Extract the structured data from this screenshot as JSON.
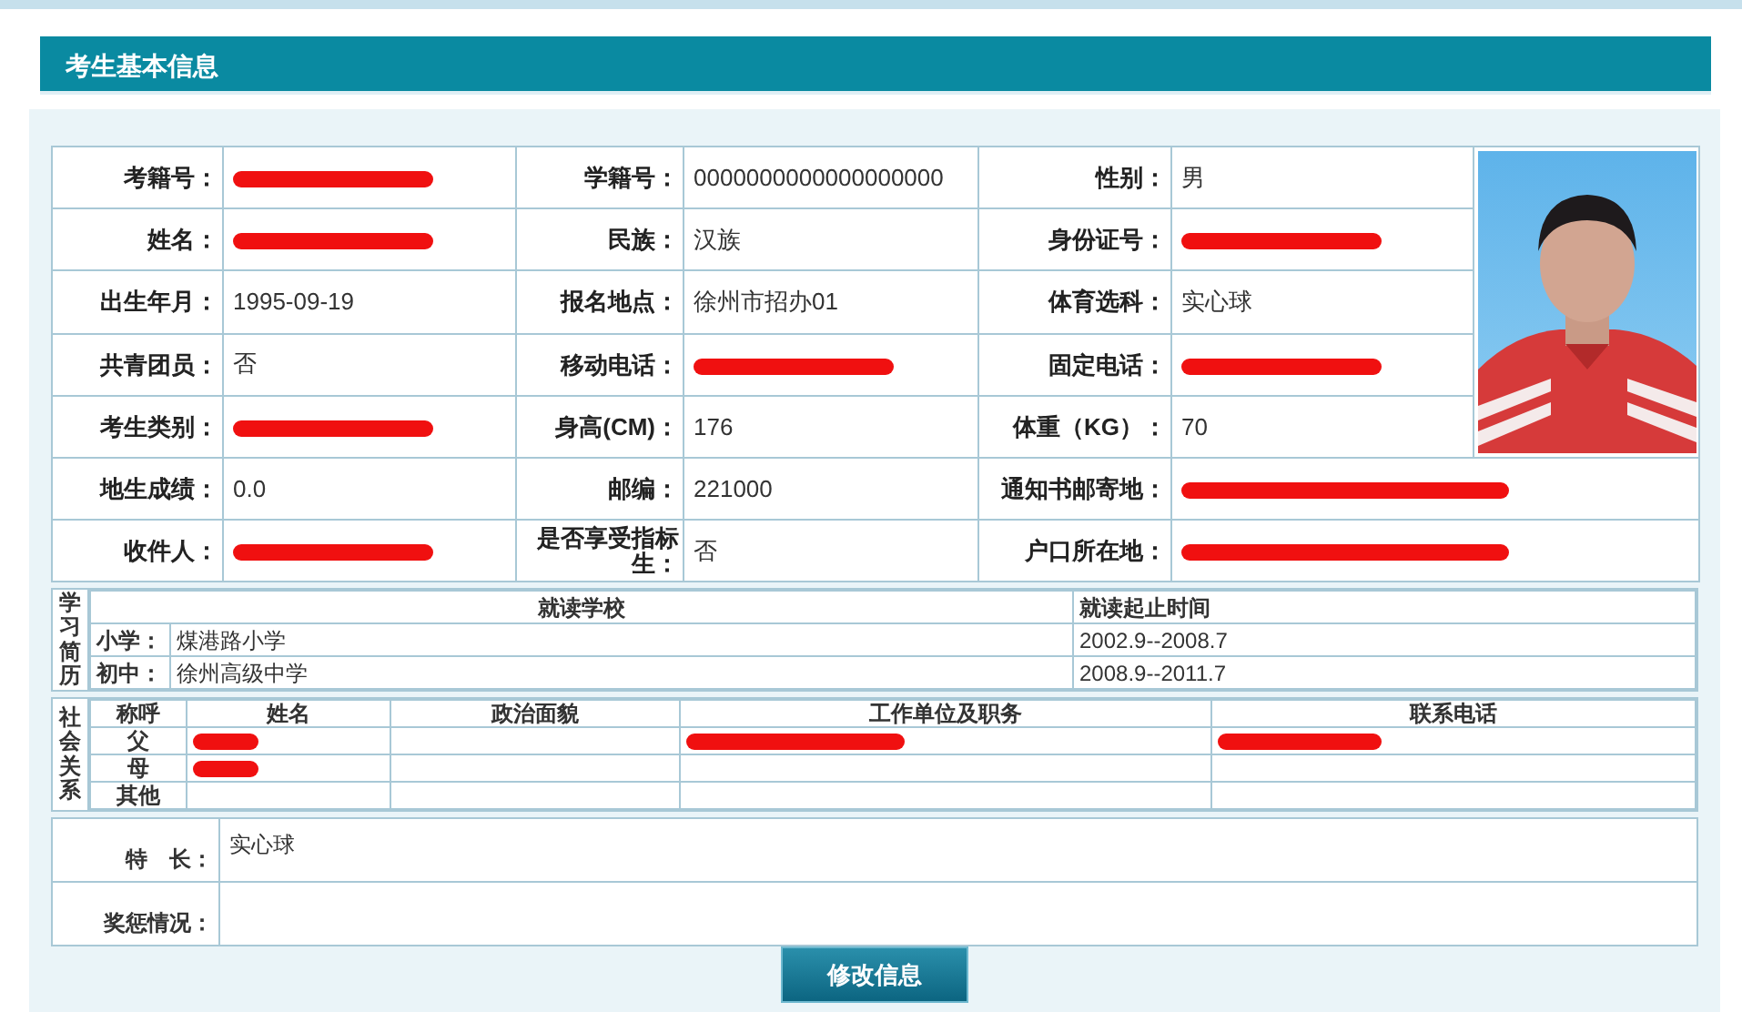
{
  "header": {
    "title": "考生基本信息"
  },
  "rows": [
    [
      {
        "label": "考籍号：",
        "redacted": true
      },
      {
        "label": "学籍号：",
        "value": "0000000000000000000",
        "redacted": false
      },
      {
        "label": "性别：",
        "value": "男",
        "redacted": false
      }
    ],
    [
      {
        "label": "姓名：",
        "redacted": true
      },
      {
        "label": "民族：",
        "value": "汉族",
        "redacted": false
      },
      {
        "label": "身份证号：",
        "redacted": true
      }
    ],
    [
      {
        "label": "出生年月：",
        "value": "1995-09-19",
        "redacted": false
      },
      {
        "label": "报名地点：",
        "value": "徐州市招办01",
        "redacted": false
      },
      {
        "label": "体育选科：",
        "value": "实心球",
        "redacted": false
      }
    ],
    [
      {
        "label": "共青团员：",
        "value": "否",
        "redacted": false
      },
      {
        "label": "移动电话：",
        "redacted": true
      },
      {
        "label": "固定电话：",
        "redacted": true
      }
    ],
    [
      {
        "label": "考生类别：",
        "redacted": true
      },
      {
        "label": "身高(CM)：",
        "value": "176",
        "redacted": false
      },
      {
        "label": "体重（KG）：",
        "value": "70",
        "redacted": false
      }
    ],
    [
      {
        "label": "地生成绩：",
        "value": "0.0",
        "redacted": false
      },
      {
        "label": "邮编：",
        "value": "221000",
        "redacted": false
      },
      {
        "label": "通知书邮寄地：",
        "redacted": true
      }
    ],
    [
      {
        "label": "收件人：",
        "redacted": true
      },
      {
        "label": "是否享受指标生：",
        "value": "否",
        "redacted": false
      },
      {
        "label": "户口所在地：",
        "redacted": true
      }
    ]
  ],
  "photo": {
    "kind": "picture"
  },
  "study": {
    "label": "学习简历",
    "columns": [
      "就读学校",
      "就读起止时间"
    ],
    "rows": [
      {
        "stage": "小学：",
        "school": "煤港路小学",
        "period": "2002.9--2008.7"
      },
      {
        "stage": "初中：",
        "school": "徐州高级中学",
        "period": "2008.9--2011.7"
      }
    ]
  },
  "relations": {
    "label": "社会关系",
    "columns": [
      "称呼",
      "姓名",
      "政治面貌",
      "工作单位及职务",
      "联系电话"
    ],
    "rows": [
      {
        "relation": "父",
        "cells": [
          {
            "redacted": true
          },
          {
            "redacted": false
          },
          {
            "redacted": true
          },
          {
            "redacted": true
          }
        ]
      },
      {
        "relation": "母",
        "cells": [
          {
            "redacted": true
          },
          {
            "redacted": false
          },
          {
            "redacted": false
          },
          {
            "redacted": false
          }
        ]
      },
      {
        "relation": "其他",
        "cells": [
          {
            "redacted": false
          },
          {
            "redacted": false
          },
          {
            "redacted": false
          },
          {
            "redacted": false
          }
        ]
      }
    ]
  },
  "extras": [
    {
      "label": "特　长：",
      "value": "实心球"
    },
    {
      "label": "奖惩情况："
    }
  ],
  "button": {
    "label": "修改信息"
  }
}
